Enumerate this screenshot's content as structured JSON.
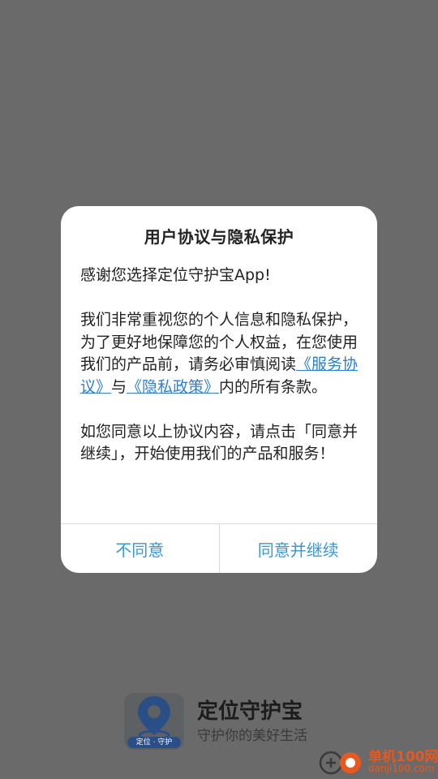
{
  "dialog": {
    "title": "用户协议与隐私保护",
    "intro": "感谢您选择定位守护宝App!",
    "para2_before": "我们非常重视您的个人信息和隐私保护，为了更好地保障您的个人权益，在您使用我们的产品前，请务必审慎阅读",
    "link_service": "《服务协议》",
    "para2_and": "与",
    "link_privacy": "《隐私政策》",
    "para2_after": "内的所有条款。",
    "para3": "如您同意以上协议内容，请点击「同意并继续」，开始使用我们的产品和服务！",
    "btn_disagree": "不同意",
    "btn_agree": "同意并继续"
  },
  "brand": {
    "logo_band_text": "定位 · 守护",
    "name": "定位守护宝",
    "slogan": "守护你的美好生活"
  },
  "watermark": {
    "line1": "单机100网",
    "line2": "danji100.com"
  },
  "colors": {
    "overlay": "#6a6a6a",
    "link": "#2a7fd6",
    "button_text": "#3b96d6",
    "logo_blue": "#2a4f86",
    "watermark": "#e8581f"
  }
}
